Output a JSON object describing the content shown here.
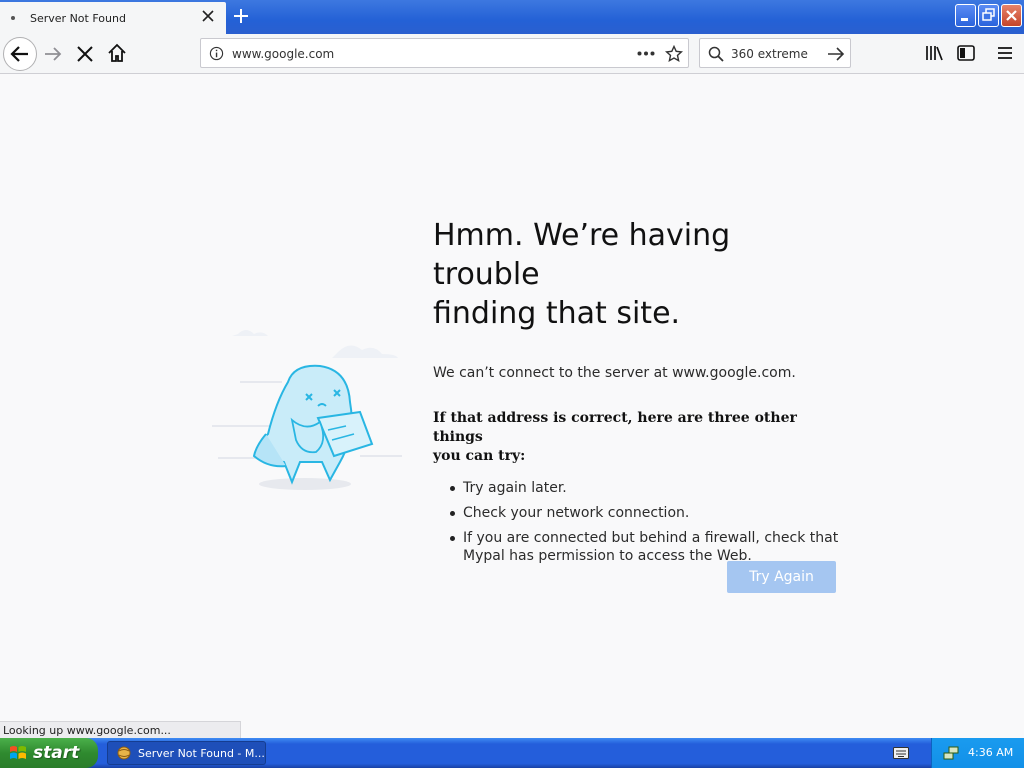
{
  "window": {
    "tab_title": "Server Not Found",
    "colors": {
      "accent": "#245edb",
      "button": "#a5c6f1",
      "page_bg": "#f9f9fa"
    }
  },
  "navbar": {
    "url": "www.google.com",
    "search_text": "360 extreme",
    "icons": [
      "back-icon",
      "forward-icon",
      "stop-icon",
      "home-icon",
      "info-icon",
      "more-icon",
      "star-icon",
      "search-icon",
      "go-arrow-icon",
      "library-icon",
      "sidebar-icon",
      "menu-icon"
    ]
  },
  "error_page": {
    "headline_line1": "Hmm. We’re having trouble",
    "headline_line2": "finding that site.",
    "description": "We can’t connect to the server at www.google.com.",
    "suggest_title_line1": "If that address is correct, here are three other things",
    "suggest_title_line2": "you can try:",
    "tips": [
      "Try again later.",
      "Check your network connection.",
      "If you are connected but behind a firewall, check that Mypal has permission to access the Web."
    ],
    "try_again_label": "Try Again"
  },
  "status": {
    "text": "Looking up www.google.com..."
  },
  "taskbar": {
    "start_label": "start",
    "task_label": "Server Not Found - M...",
    "clock": "4:36 AM"
  }
}
